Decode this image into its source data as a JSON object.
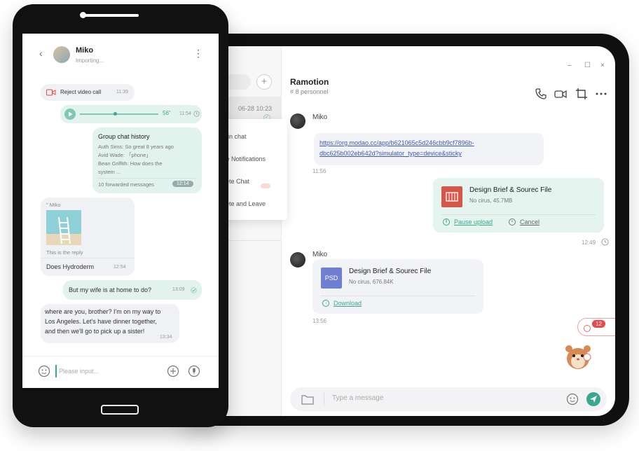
{
  "tablet": {
    "chat_title": "Ramotion",
    "chat_subtitle": "# 8 personnel",
    "window_controls": [
      "–",
      "☐",
      "×"
    ],
    "list_item_date": "06-28 10:23",
    "context_menu": [
      "pin chat",
      "te Notifications",
      "lete Chat",
      "lete and Leave"
    ],
    "messages": {
      "link": {
        "sender": "Miko",
        "url_line1": "https://org.modao.cc/app/b621065c5d246cbb9cf7896b-",
        "url_line2": "dbc625b002eb642d?simulator_type=device&sticky",
        "time": "11:56"
      },
      "my_file": {
        "title": "Design Brief & Sourec File",
        "size": "No cirus, 45.7MB",
        "action1": "Pause upload",
        "action2": "Cancel",
        "time": "12:49"
      },
      "their_file": {
        "sender": "Miko",
        "icon_label": "PSD",
        "title": "Design Brief & Sourec File",
        "size": "No cirus, 676.84K",
        "action": "Download",
        "time": "13:56"
      }
    },
    "unread_badge": "12",
    "input_placeholder": "Type a message"
  },
  "phone": {
    "contact_name": "Miko",
    "contact_status": "Importing...",
    "messages": {
      "reject": {
        "label": "Reject video call",
        "time": "11:39"
      },
      "voice": {
        "duration": "56\"",
        "time": "11:54"
      },
      "history": {
        "title": "Group chat history",
        "line1": "Auth Sims: So great 8 years ago",
        "line2": "Avid Wade: 「phone」",
        "line3": "Bean Griffith: How does the",
        "line4": "system ...",
        "footer": "10 forwarded messages",
        "time": "12:14"
      },
      "reply": {
        "quote_from": "\" Miko",
        "caption": "This is the reply",
        "text": "Does Hydroderm",
        "time": "12:54"
      },
      "wife": {
        "text": "But my wife is at home to do?",
        "time": "13:09"
      },
      "brother": {
        "line1": "where are you, brother? I'm on my way to",
        "line2": "Los Angeles. Let's have dinner together,",
        "line3": "and then we'll go to pick up a sister!",
        "time": "13:34"
      }
    },
    "input_placeholder": "Please input..."
  },
  "colors": {
    "accent": "#3aa790",
    "danger": "#e84848",
    "link": "#3b5bb5"
  }
}
